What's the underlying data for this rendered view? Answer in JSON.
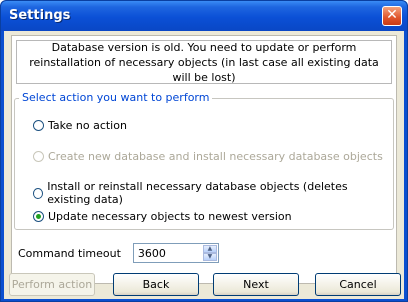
{
  "window": {
    "title": "Settings"
  },
  "message": {
    "line1": "Database version is old. You need to update or perform",
    "line2": "reinstallation of necessary objects (in last case all existing data will be lost)"
  },
  "actions": {
    "legend": "Select action you want to perform",
    "options": [
      {
        "label": "Take no action",
        "selected": false,
        "disabled": false
      },
      {
        "label": "Create new database and install necessary database objects",
        "selected": false,
        "disabled": true
      },
      {
        "label": "Install or reinstall necessary database objects (deletes existing data)",
        "selected": false,
        "disabled": false
      },
      {
        "label": "Update necessary objects to newest version",
        "selected": true,
        "disabled": false
      }
    ]
  },
  "timeout": {
    "label": "Command timeout",
    "value": "3600"
  },
  "buttons": {
    "perform": "Perform action",
    "back": "Back",
    "next": "Next",
    "cancel": "Cancel"
  },
  "colors": {
    "title_bar": "#0b50d6",
    "legend": "#0046d5",
    "selected_dot": "#21a121"
  },
  "icons": {
    "close": "close-icon",
    "spin_up": "chevron-up-icon",
    "spin_down": "chevron-down-icon"
  }
}
